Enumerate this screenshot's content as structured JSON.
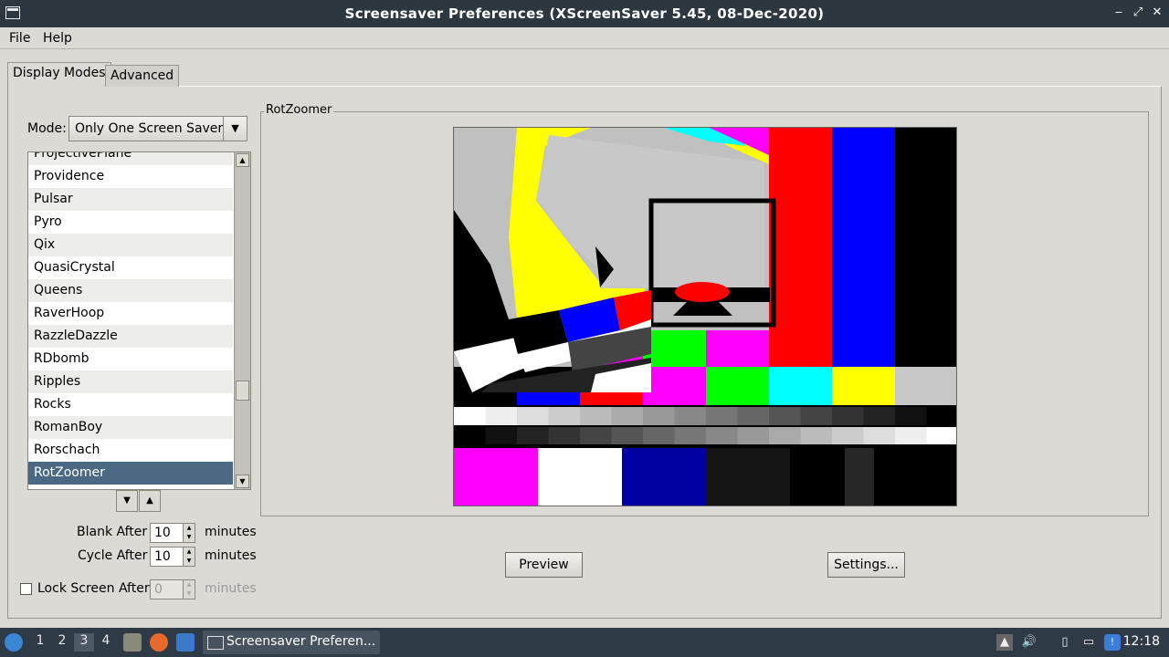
{
  "window": {
    "title": "Screensaver Preferences  (XScreenSaver 5.45, 08-Dec-2020)",
    "controls": {
      "minimize": "‒",
      "maximize": "⤢",
      "close": "✕"
    }
  },
  "menu": {
    "file": "File",
    "help": "Help"
  },
  "tabs": {
    "display_modes": "Display Modes",
    "advanced": "Advanced"
  },
  "mode": {
    "label": "Mode:",
    "value": "Only One Screen Saver"
  },
  "savers": {
    "items": [
      "ProjectivePlane",
      "Providence",
      "Pulsar",
      "Pyro",
      "Qix",
      "QuasiCrystal",
      "Queens",
      "RaverHoop",
      "RazzleDazzle",
      "RDbomb",
      "Ripples",
      "Rocks",
      "RomanBoy",
      "Rorschach",
      "RotZoomer"
    ],
    "selected": "RotZoomer"
  },
  "timing": {
    "blank_label": "Blank After",
    "blank_value": "10",
    "cycle_label": "Cycle After",
    "cycle_value": "10",
    "lock_label": "Lock Screen After",
    "lock_value": "0",
    "lock_checked": false,
    "unit": "minutes"
  },
  "preview": {
    "frame_label": "RotZoomer",
    "preview_button": "Preview",
    "settings_button": "Settings..."
  },
  "taskbar": {
    "workspaces": [
      "1",
      "2",
      "3",
      "4"
    ],
    "current_workspace": "3",
    "task_title": "Screensaver Preferen...",
    "clock": "12:18"
  },
  "colors": {
    "title_bg": "#2d3740",
    "selection": "#4b6983",
    "taskbar_bg": "#2e3a46"
  }
}
